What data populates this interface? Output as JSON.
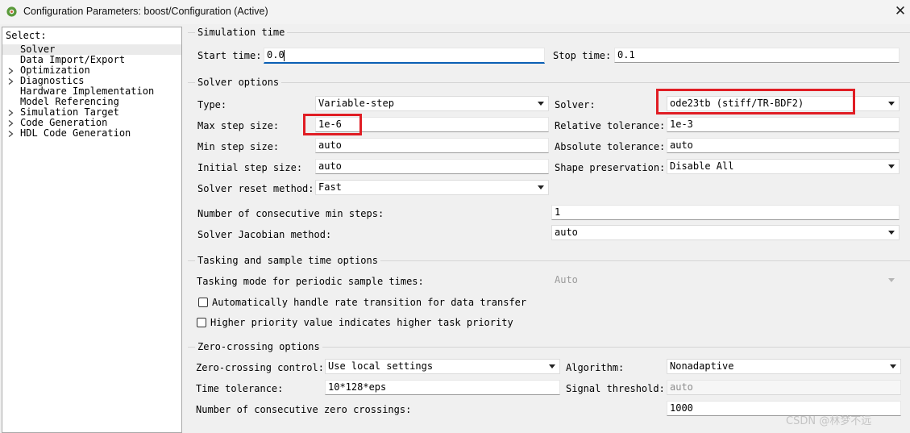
{
  "window": {
    "title": "Configuration Parameters: boost/Configuration (Active)",
    "close_glyph": "✕",
    "icon": "matlab-gear-icon"
  },
  "tree": {
    "heading": "Select:",
    "items": [
      {
        "label": "Solver",
        "expandable": false,
        "selected": true
      },
      {
        "label": "Data Import/Export",
        "expandable": false
      },
      {
        "label": "Optimization",
        "expandable": true
      },
      {
        "label": "Diagnostics",
        "expandable": true
      },
      {
        "label": "Hardware Implementation",
        "expandable": false
      },
      {
        "label": "Model Referencing",
        "expandable": false
      },
      {
        "label": "Simulation Target",
        "expandable": true
      },
      {
        "label": "Code Generation",
        "expandable": true
      },
      {
        "label": "HDL Code Generation",
        "expandable": true
      }
    ]
  },
  "sim_time": {
    "title": "Simulation time",
    "start_label": "Start time:",
    "start_value": "0.0",
    "stop_label": "Stop time:",
    "stop_value": "0.1"
  },
  "solver_opts": {
    "title": "Solver options",
    "type_label": "Type:",
    "type_value": "Variable-step",
    "solver_label": "Solver:",
    "solver_value": "ode23tb (stiff/TR-BDF2)",
    "max_step_label": "Max step size:",
    "max_step_value": "1e-6",
    "rel_tol_label": "Relative tolerance:",
    "rel_tol_value": "1e-3",
    "min_step_label": "Min step size:",
    "min_step_value": "auto",
    "abs_tol_label": "Absolute tolerance:",
    "abs_tol_value": "auto",
    "init_step_label": "Initial step size:",
    "init_step_value": "auto",
    "shape_label": "Shape preservation:",
    "shape_value": "Disable All",
    "reset_label": "Solver reset method:",
    "reset_value": "Fast",
    "consec_min_label": "Number of consecutive min steps:",
    "consec_min_value": "1",
    "jacobian_label": "Solver Jacobian method:",
    "jacobian_value": "auto"
  },
  "tasking": {
    "title": "Tasking and sample time options",
    "mode_label": "Tasking mode for periodic sample times:",
    "mode_value": "Auto",
    "auto_rate_label": "Automatically handle rate transition for data transfer",
    "auto_rate_checked": false,
    "higher_prio_label": "Higher priority value indicates higher task priority",
    "higher_prio_checked": false
  },
  "zero_crossing": {
    "title": "Zero-crossing options",
    "control_label": "Zero-crossing control:",
    "control_value": "Use local settings",
    "algorithm_label": "Algorithm:",
    "algorithm_value": "Nonadaptive",
    "time_tol_label": "Time tolerance:",
    "time_tol_value": "10*128*eps",
    "signal_thr_label": "Signal threshold:",
    "signal_thr_value": "auto",
    "consec_zc_label": "Number of consecutive zero crossings:",
    "consec_zc_value": "1000"
  },
  "watermark": "CSDN @林梦不远",
  "colors": {
    "highlight_box": "#e01d24",
    "focus_underline": "#0a5fb4"
  }
}
